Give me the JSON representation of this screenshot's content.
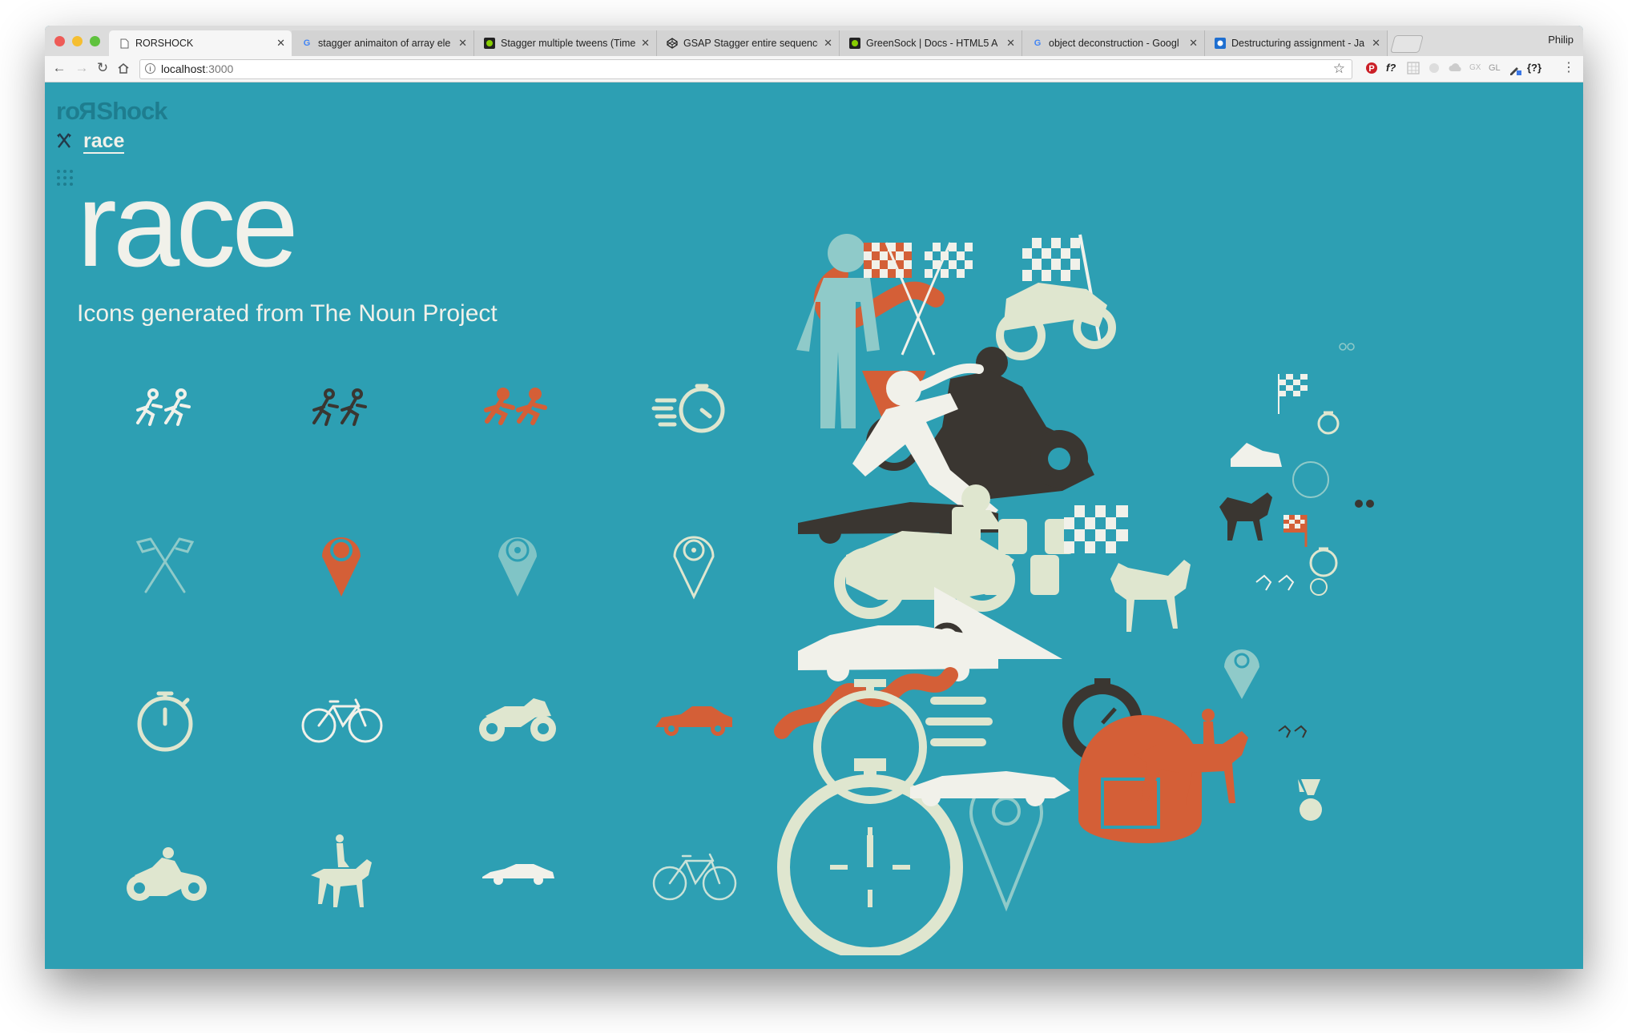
{
  "browser": {
    "tabs": [
      {
        "title": "RORSHOCK",
        "active": true,
        "favicon": "page-icon"
      },
      {
        "title": "stagger animaiton of array ele",
        "active": false,
        "favicon": "google-icon"
      },
      {
        "title": "Stagger multiple tweens (Time",
        "active": false,
        "favicon": "greensock-icon"
      },
      {
        "title": "GSAP Stagger entire sequence",
        "active": false,
        "favicon": "codepen-icon"
      },
      {
        "title": "GreenSock | Docs - HTML5 A",
        "active": false,
        "favicon": "greensock-icon"
      },
      {
        "title": "object deconstruction - Googl",
        "active": false,
        "favicon": "google-icon"
      },
      {
        "title": "Destructuring assignment - Ja",
        "active": false,
        "favicon": "mdn-icon"
      }
    ],
    "profile_name": "Philip",
    "url_host": "localhost",
    "url_port": ":3000",
    "extensions": [
      "f?",
      "GL",
      "{?}"
    ]
  },
  "page": {
    "brand_start": "ro",
    "brand_rev": "R",
    "brand_end": "Shock",
    "breadcrumb": "race",
    "title": "race",
    "subtitle": "Icons generated from The Noun Project"
  },
  "icons": [
    {
      "name": "runners-outline-icon",
      "color": "#f1f1ea"
    },
    {
      "name": "runners-dark-icon",
      "color": "#3a3631"
    },
    {
      "name": "runners-orange-icon",
      "color": "#d45f37"
    },
    {
      "name": "stopwatch-speed-icon",
      "color": "#dfe6cf"
    },
    {
      "name": "crossed-flags-icon",
      "color": "#8fcac9"
    },
    {
      "name": "map-pin-orange-icon",
      "color": "#d45f37"
    },
    {
      "name": "map-pin-timer-icon",
      "color": "#8fcac9"
    },
    {
      "name": "map-pin-timer-outline-icon",
      "color": "#dfe6cf"
    },
    {
      "name": "stopwatch-icon",
      "color": "#dfe6cf"
    },
    {
      "name": "bicycle-icon",
      "color": "#f1f1ea"
    },
    {
      "name": "sport-motorcycle-icon",
      "color": "#dfe6cf"
    },
    {
      "name": "race-car-icon",
      "color": "#d45f37"
    },
    {
      "name": "motorcycle-rider-icon",
      "color": "#dfe6cf"
    },
    {
      "name": "horse-rider-icon",
      "color": "#dfe6cf"
    },
    {
      "name": "classic-car-icon",
      "color": "#f1f1ea"
    },
    {
      "name": "road-bike-icon",
      "color": "#c9e2d8"
    }
  ],
  "colors": {
    "background": "#2d9fb3",
    "cream": "#f1f1ea",
    "pale_green": "#dfe6cf",
    "orange": "#d45f37",
    "dark": "#3a3631",
    "mint": "#8fcac9"
  }
}
